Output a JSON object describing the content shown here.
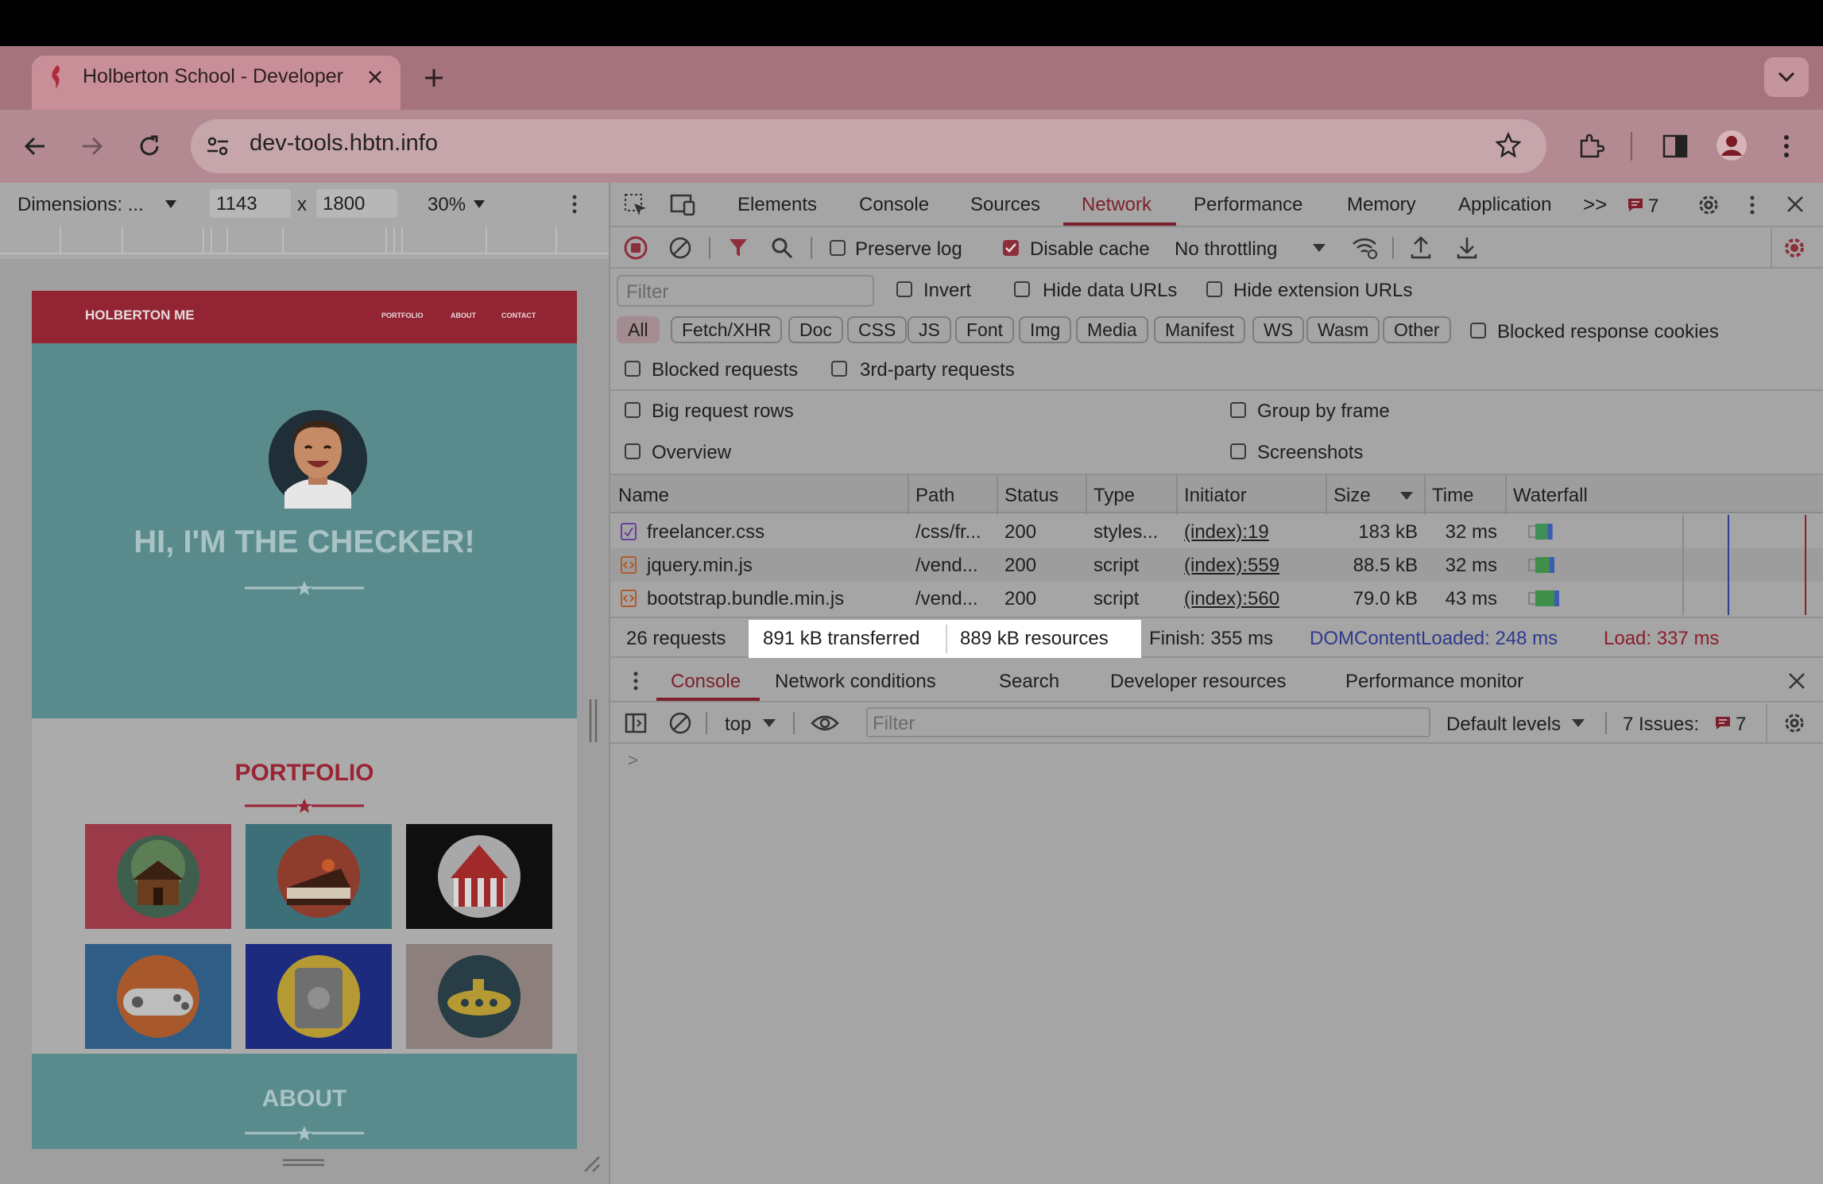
{
  "browser": {
    "tab_title": "Holberton School - Developer",
    "url": "dev-tools.hbtn.info"
  },
  "device_toolbar": {
    "dimensions_label": "Dimensions: ...",
    "width": "1143",
    "x_sep": "x",
    "height": "1800",
    "zoom": "30%"
  },
  "page": {
    "brand": "HOLBERTON ME",
    "nav": [
      "PORTFOLIO",
      "ABOUT",
      "CONTACT"
    ],
    "hero_title": "HI, I'M THE CHECKER!",
    "portfolio_title": "PORTFOLIO",
    "about_title": "ABOUT",
    "tiles": [
      {
        "name": "cabin",
        "bg": "#9a3a48",
        "circle": "#3f5f4e"
      },
      {
        "name": "cake",
        "bg": "#3d6f78",
        "circle": "#8e3c2c"
      },
      {
        "name": "circus",
        "bg": "#0f0f0f",
        "circle": "#a8a8a8"
      },
      {
        "name": "controller",
        "bg": "#2f5d86",
        "circle": "#a8592c"
      },
      {
        "name": "safe",
        "bg": "#1c2b7e",
        "circle": "#b59a33"
      },
      {
        "name": "submarine",
        "bg": "#8c7f7c",
        "circle": "#283d46"
      }
    ],
    "colors": {
      "nav": "#932433",
      "hero": "#5a8b8c",
      "accent": "#9a2433"
    }
  },
  "devtools": {
    "tabs": [
      "Elements",
      "Console",
      "Sources",
      "Network",
      "Performance",
      "Memory",
      "Application"
    ],
    "active_tab": "Network",
    "more_tabs": ">>",
    "issues_count": "7",
    "network_toolbar": {
      "preserve_log": "Preserve log",
      "disable_cache": "Disable cache",
      "throttling": "No throttling"
    },
    "filter": {
      "placeholder": "Filter",
      "invert": "Invert",
      "hide_data_urls": "Hide data URLs",
      "hide_extension_urls": "Hide extension URLs",
      "types": [
        "All",
        "Fetch/XHR",
        "Doc",
        "CSS",
        "JS",
        "Font",
        "Img",
        "Media",
        "Manifest",
        "WS",
        "Wasm",
        "Other"
      ],
      "blocked_response_cookies": "Blocked response cookies",
      "blocked_requests": "Blocked requests",
      "third_party": "3rd-party requests",
      "big_request_rows": "Big request rows",
      "group_by_frame": "Group by frame",
      "overview": "Overview",
      "screenshots": "Screenshots"
    },
    "table": {
      "headers": [
        "Name",
        "Path",
        "Status",
        "Type",
        "Initiator",
        "Size",
        "Time",
        "Waterfall"
      ],
      "rows": [
        {
          "name": "freelancer.css",
          "path": "/css/fr...",
          "status": "200",
          "type": "styles...",
          "initiator": "(index):19",
          "size": "183 kB",
          "time": "32 ms",
          "waiting": 0.08,
          "download": 0.18
        },
        {
          "name": "jquery.min.js",
          "path": "/vend...",
          "status": "200",
          "type": "script",
          "initiator": "(index):559",
          "size": "88.5 kB",
          "time": "32 ms",
          "waiting": 0.08,
          "download": 0.2
        },
        {
          "name": "bootstrap.bundle.min.js",
          "path": "/vend...",
          "status": "200",
          "type": "script",
          "initiator": "(index):560",
          "size": "79.0 kB",
          "time": "43 ms",
          "waiting": 0.08,
          "download": 0.25
        }
      ]
    },
    "summary": {
      "requests": "26 requests",
      "transferred": "891 kB transferred",
      "resources": "889 kB resources",
      "finish": "Finish: 355 ms",
      "dcl": "DOMContentLoaded: 248 ms",
      "load": "Load: 337 ms"
    },
    "drawer": {
      "tabs": [
        "Console",
        "Network conditions",
        "Search",
        "Developer resources",
        "Performance monitor"
      ],
      "active": "Console",
      "context": "top",
      "filter_placeholder": "Filter",
      "levels": "Default levels",
      "issues_label": "7 Issues:",
      "issues_count": "7",
      "prompt": ">"
    }
  }
}
